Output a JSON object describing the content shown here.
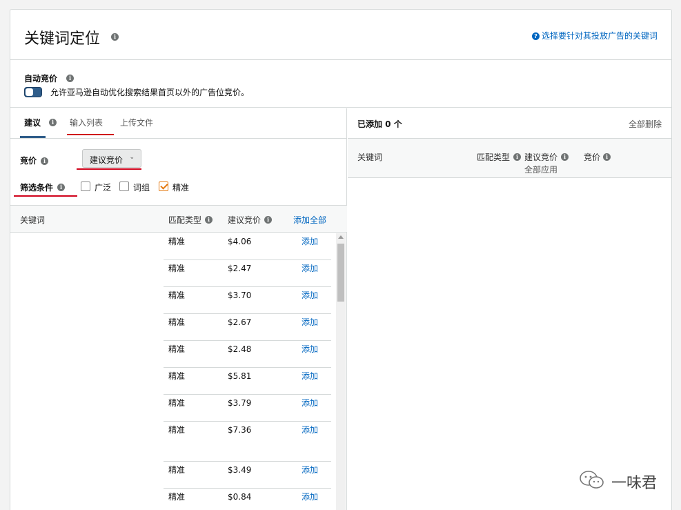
{
  "header": {
    "title": "关键词定位",
    "help_link": "选择要针对其投放广告的关键词"
  },
  "auto_bid": {
    "title": "自动竞价",
    "toggle_on": true,
    "description": "允许亚马逊自动优化搜索结果首页以外的广告位竞价。"
  },
  "tabs": [
    {
      "label": "建议",
      "active": true
    },
    {
      "label": "输入列表"
    },
    {
      "label": "上传文件"
    }
  ],
  "bid": {
    "label": "竞价",
    "select_value": "建议竞价"
  },
  "filter": {
    "label": "筛选条件",
    "options": [
      {
        "label": "广泛",
        "checked": false
      },
      {
        "label": "词组",
        "checked": false
      },
      {
        "label": "精准",
        "checked": true
      }
    ]
  },
  "table": {
    "columns": {
      "keyword": "关键词",
      "match_type": "匹配类型",
      "suggested_bid": "建议竞价",
      "add_all": "添加全部"
    },
    "rows": [
      {
        "match": "精准",
        "bid": "$4.06",
        "action": "添加"
      },
      {
        "match": "精准",
        "bid": "$2.47",
        "action": "添加"
      },
      {
        "match": "精准",
        "bid": "$3.70",
        "action": "添加"
      },
      {
        "match": "精准",
        "bid": "$2.67",
        "action": "添加"
      },
      {
        "match": "精准",
        "bid": "$2.48",
        "action": "添加"
      },
      {
        "match": "精准",
        "bid": "$5.81",
        "action": "添加"
      },
      {
        "match": "精准",
        "bid": "$3.79",
        "action": "添加"
      },
      {
        "match": "精准",
        "bid": "$7.36",
        "action": "添加"
      },
      {
        "match": "精准",
        "bid": "$3.49",
        "action": "添加"
      },
      {
        "match": "精准",
        "bid": "$0.84",
        "action": "添加"
      }
    ]
  },
  "added": {
    "title": "已添加 0 个",
    "remove_all": "全部删除",
    "columns": {
      "keyword": "关键词",
      "match_type": "匹配类型",
      "suggested_bid": "建议竞价",
      "apply_all": "全部应用",
      "bid": "竞价"
    }
  },
  "watermark": "一味君",
  "colors": {
    "link": "#0066c0",
    "toggle": "#2f5d8a",
    "checkbox_checked": "#e47911",
    "annotation_red": "#d0021b"
  }
}
